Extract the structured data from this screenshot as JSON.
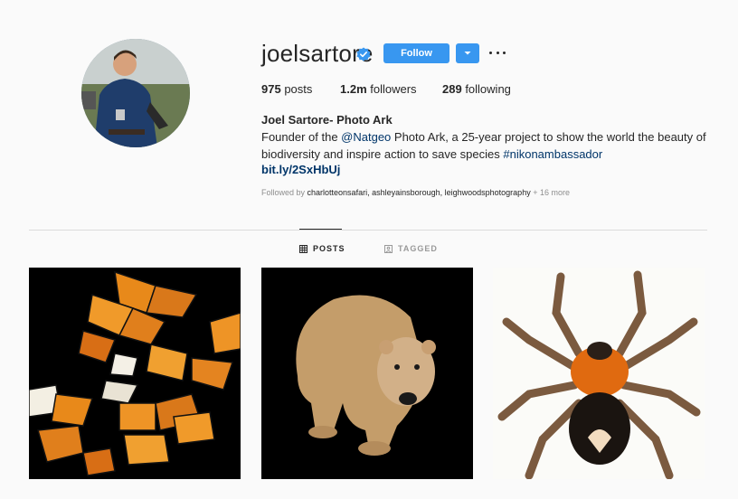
{
  "profile": {
    "username": "joelsartore",
    "verified": true,
    "follow_label": "Follow",
    "full_name": "Joel Sartore- Photo Ark",
    "bio_prefix": "Founder of the ",
    "bio_mention": "@Natgeo",
    "bio_middle": " Photo Ark, a 25-year project to show the world the beauty of biodiversity and inspire action to save species ",
    "bio_hashtag": "#nikonambassador",
    "link": "bit.ly/2SxHbUj"
  },
  "stats": {
    "posts_count": "975",
    "posts_label": " posts",
    "followers_count": "1.2m",
    "followers_label": " followers",
    "following_count": "289",
    "following_label": " following"
  },
  "followed_by": {
    "prefix": "Followed by ",
    "users": "charlotteonsafari, ashleyainsborough, leighwoodsphotography",
    "more": " + 16 more"
  },
  "tabs": [
    {
      "label": "POSTS",
      "active": true,
      "icon": "grid-icon"
    },
    {
      "label": "TAGGED",
      "active": false,
      "icon": "tag-icon"
    }
  ],
  "posts": [
    {
      "subject": "monarch-butterflies"
    },
    {
      "subject": "polar-bear"
    },
    {
      "subject": "tarantula"
    }
  ],
  "colors": {
    "accent": "#3897f0",
    "verified": "#3897f0",
    "link": "#003569",
    "muted": "#8e8e8e"
  }
}
